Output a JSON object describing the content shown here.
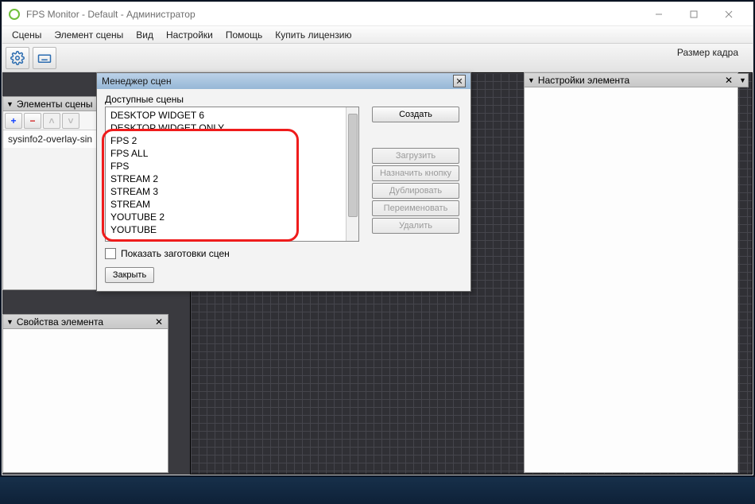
{
  "window": {
    "title": "FPS Monitor - Default - Администратор"
  },
  "menubar": [
    "Сцены",
    "Элемент сцены",
    "Вид",
    "Настройки",
    "Помощь",
    "Купить лицензию"
  ],
  "toolbar": {
    "frame_size_label": "Размер кадра"
  },
  "panels": {
    "elements": {
      "title": "Элементы сцены",
      "item": "sysinfo2-overlay-sin"
    },
    "props": {
      "title": "Свойства элемента"
    },
    "settings": {
      "title": "Настройки элемента"
    }
  },
  "dialog": {
    "title": "Менеджер сцен",
    "available_label": "Доступные сцены",
    "scenes": [
      "DESKTOP WIDGET 6",
      "DESKTOP WIDGET ONLY",
      "FPS 2",
      "FPS ALL",
      "FPS",
      "STREAM 2",
      "STREAM 3",
      "STREAM",
      "YOUTUBE 2",
      "YOUTUBE"
    ],
    "buttons": {
      "create": "Создать",
      "load": "Загрузить",
      "assign": "Назначить кнопку",
      "duplicate": "Дублировать",
      "rename": "Переименовать",
      "delete": "Удалить"
    },
    "show_templates": "Показать заготовки сцен",
    "close": "Закрыть"
  }
}
